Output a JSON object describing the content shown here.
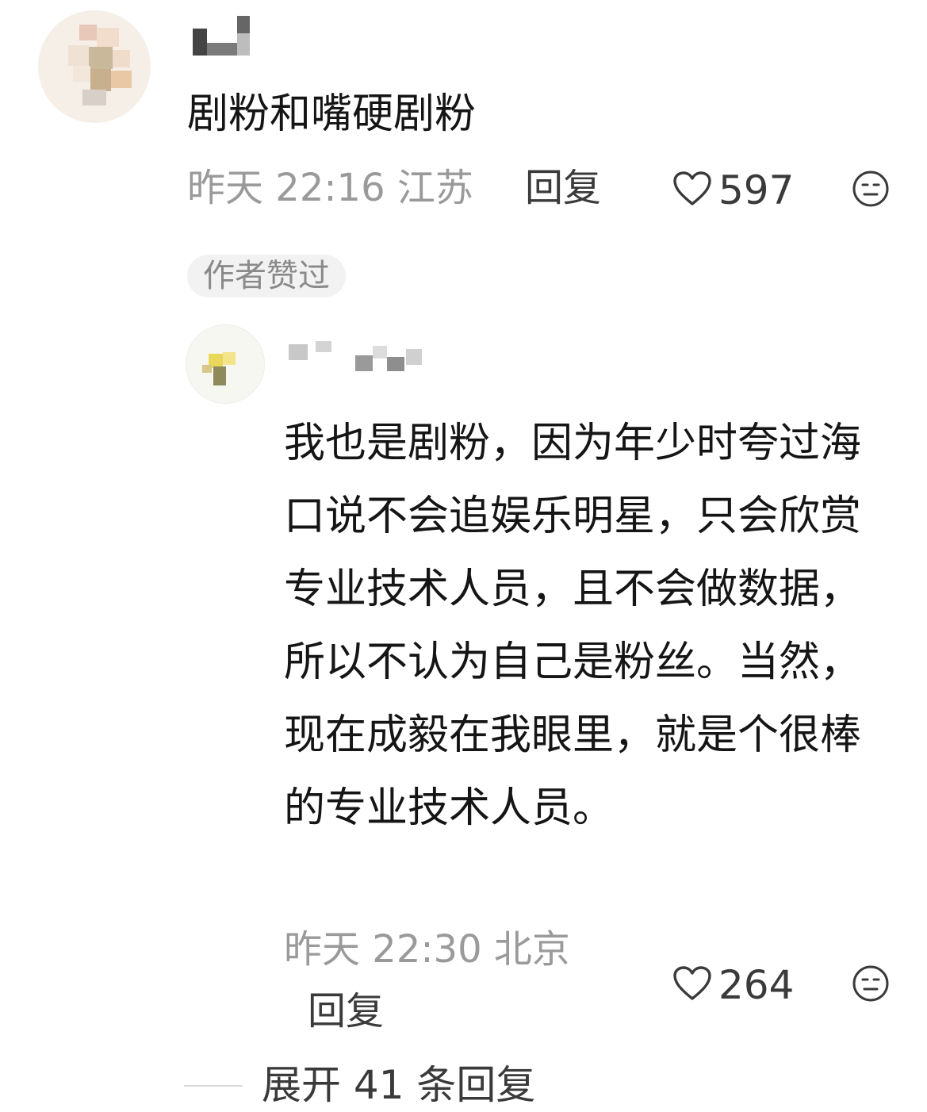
{
  "main_comment": {
    "text": "剧粉和嘴硬剧粉",
    "date": "昨天",
    "time": "22:16",
    "location": "江苏",
    "reply_label": "回复",
    "like_count": "597",
    "badge": "作者赞过"
  },
  "reply_comment": {
    "text": "我也是剧粉，因为年少时夸过海口说不会追娱乐明星，只会欣赏专业技术人员，且不会做数据，所以不认为自己是粉丝。当然，现在成毅在我眼里，就是个很棒的专业技术人员。",
    "date": "昨天",
    "time": "22:30",
    "location": "北京",
    "reply_label": "回复",
    "like_count": "264"
  },
  "expand": {
    "label": "展开 41 条回复"
  },
  "icons": {
    "like": "heart-outline-icon",
    "dislike": "expressionless-face-icon"
  },
  "colors": {
    "text": "#151515",
    "meta": "#9a9a9a",
    "action": "#3a3a3a",
    "badge_bg": "#f2f2f2"
  }
}
